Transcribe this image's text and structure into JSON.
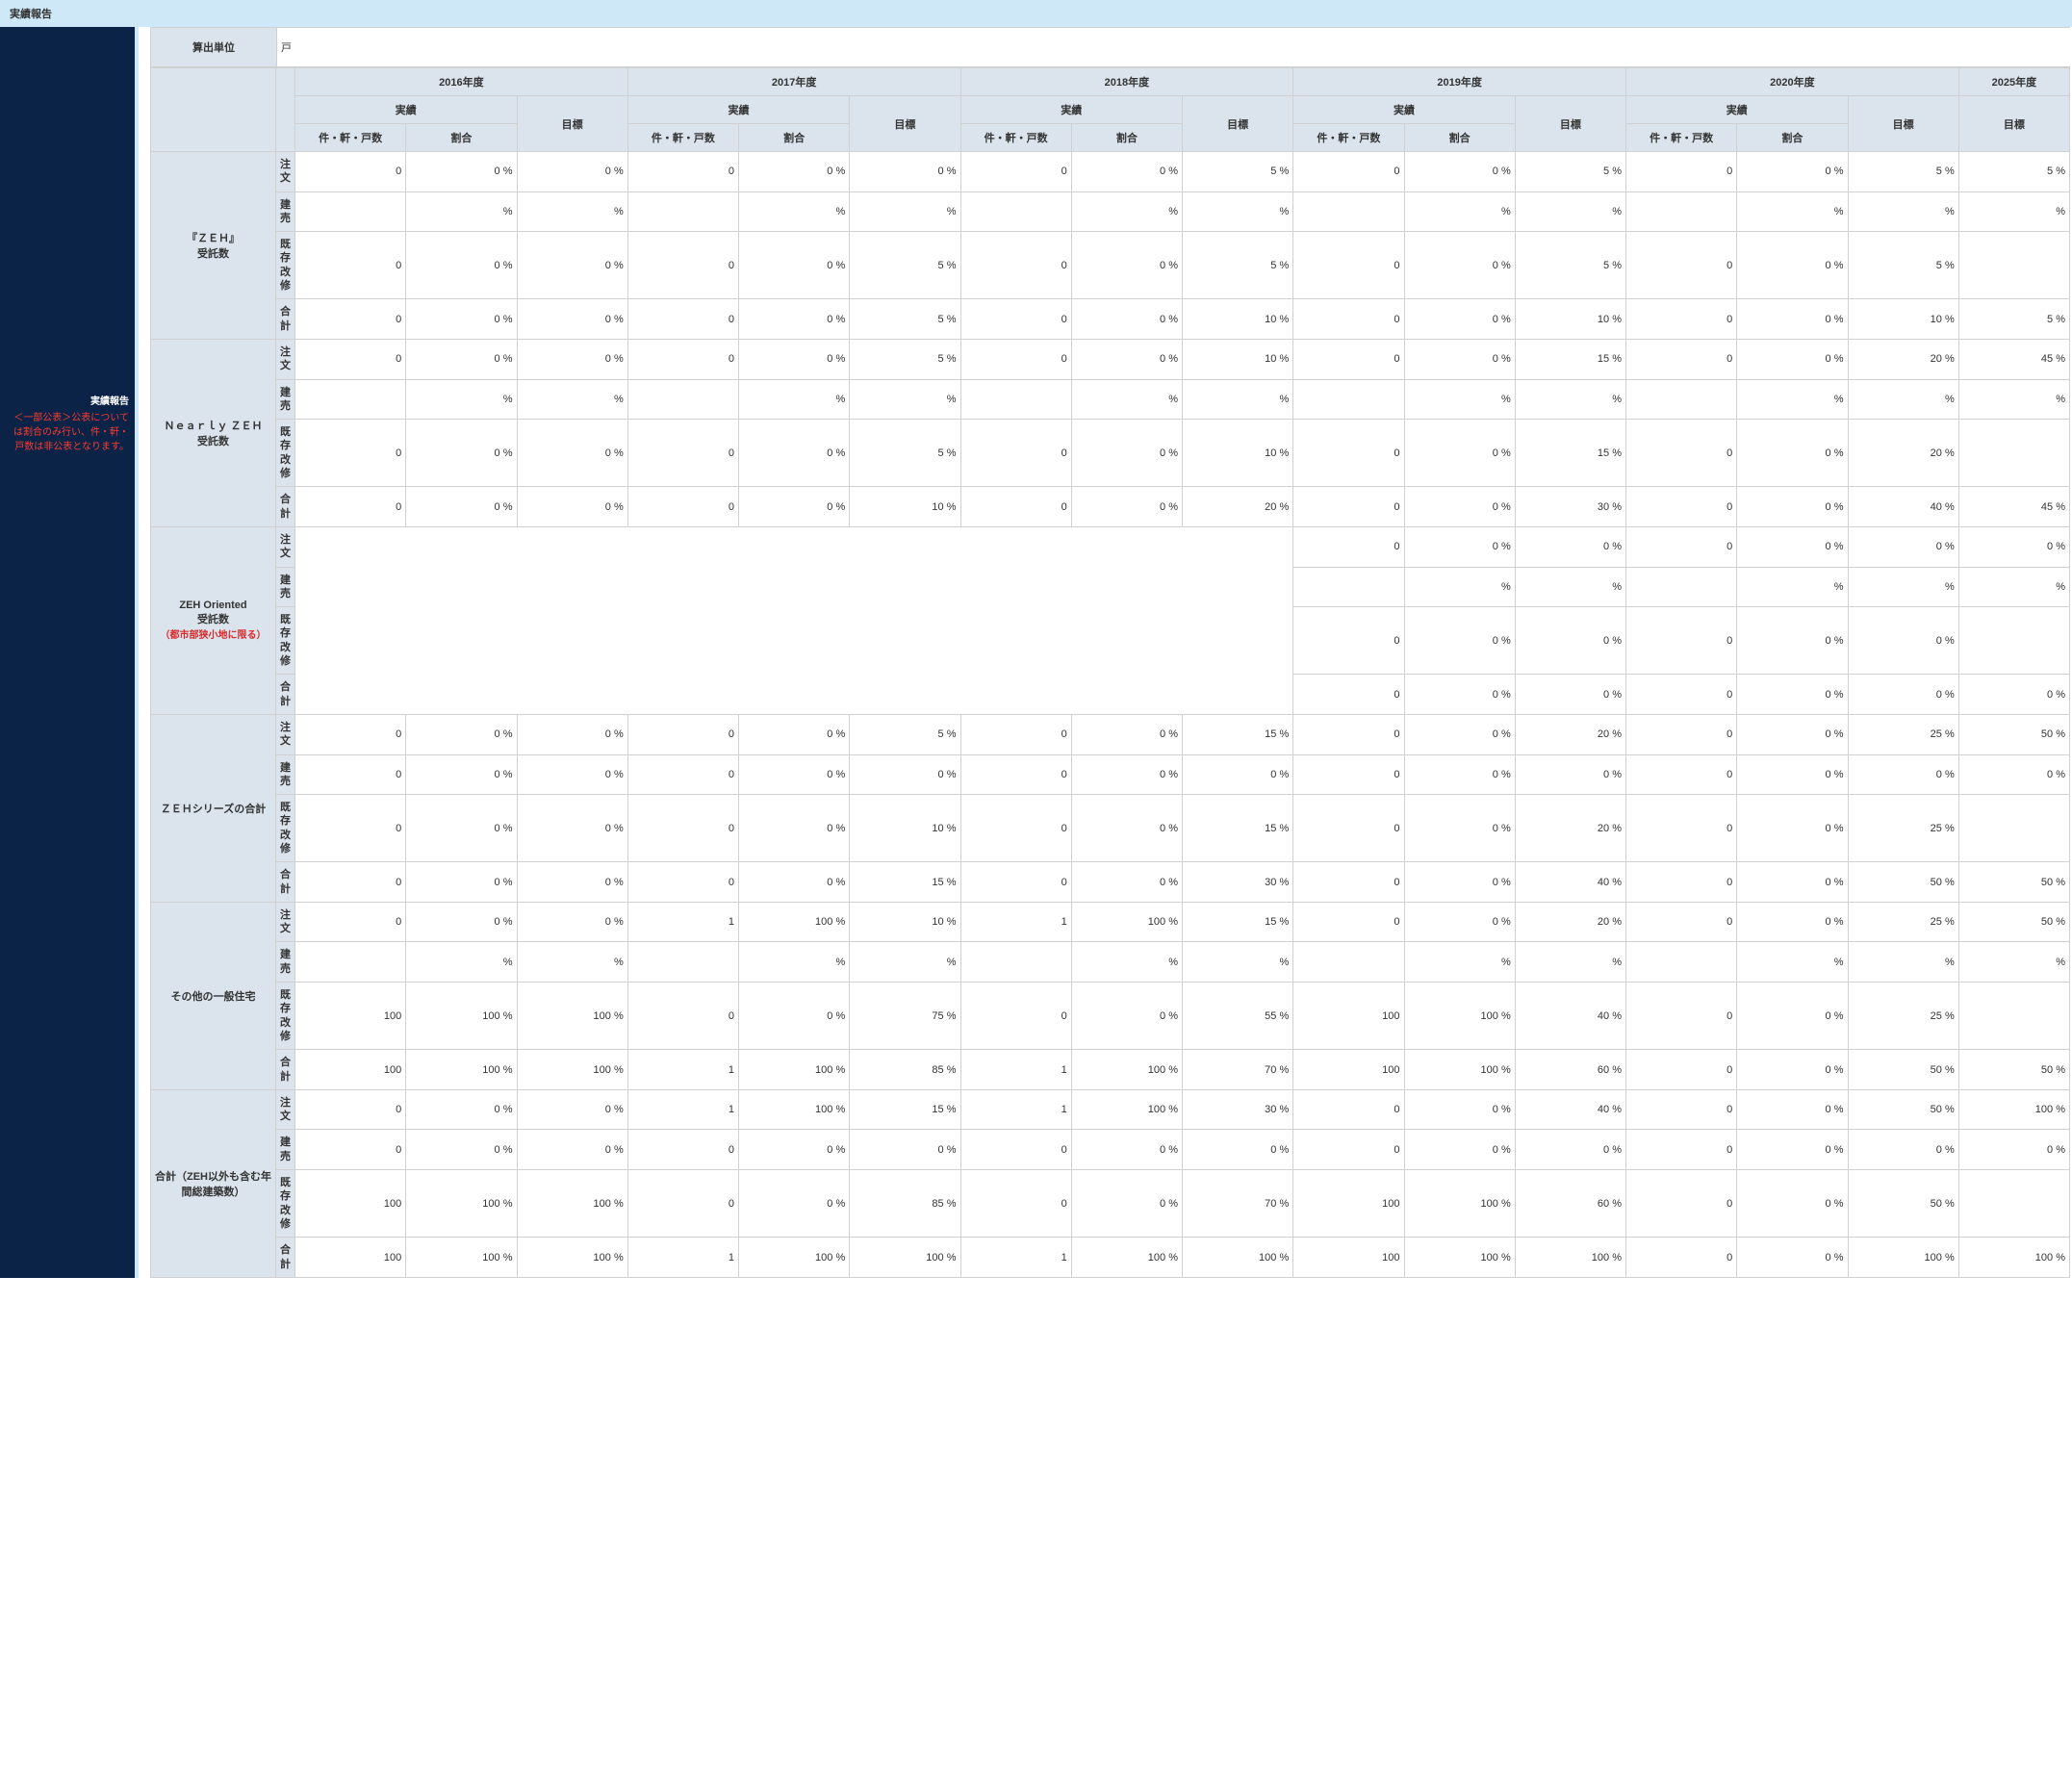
{
  "page_title": "実績報告",
  "sidebar": {
    "heading": "実績報告",
    "note_line1": "＜一部公表＞公表については割合のみ行い、件・軒・戸数は非公表となります。"
  },
  "unit_row": {
    "label": "算出単位",
    "value": "戸"
  },
  "years": [
    "2016年度",
    "2017年度",
    "2018年度",
    "2019年度",
    "2020年度",
    "2025年度"
  ],
  "sub_headers": {
    "actual": "実績",
    "count": "件・軒・戸数",
    "ratio": "割合",
    "target": "目標"
  },
  "sub_short_count": "件・軒・戸数",
  "row_sub_labels": [
    "注文",
    "建売",
    "既存改修",
    "合計"
  ],
  "categories": [
    {
      "name_line1": "『ＺＥＨ』",
      "name_line2": "受託数",
      "rows": [
        {
          "cells": [
            "0",
            "0 %",
            "0 %",
            "0",
            "0 %",
            "0 %",
            "0",
            "0 %",
            "5 %",
            "0",
            "0 %",
            "5 %",
            "0",
            "0 %",
            "5 %",
            "5 %"
          ]
        },
        {
          "cells": [
            "",
            "%",
            "%",
            "",
            "%",
            "%",
            "",
            "%",
            "%",
            "",
            "%",
            "%",
            "",
            "%",
            "%",
            "%"
          ]
        },
        {
          "cells": [
            "0",
            "0 %",
            "0 %",
            "0",
            "0 %",
            "5 %",
            "0",
            "0 %",
            "5 %",
            "0",
            "0 %",
            "5 %",
            "0",
            "0 %",
            "5 %",
            ""
          ]
        },
        {
          "cells": [
            "0",
            "0 %",
            "0 %",
            "0",
            "0 %",
            "5 %",
            "0",
            "0 %",
            "10 %",
            "0",
            "0 %",
            "10 %",
            "0",
            "0 %",
            "10 %",
            "5 %"
          ]
        }
      ]
    },
    {
      "name_line1": "Ｎｅａｒｌｙ ＺＥＨ",
      "name_line2": "受託数",
      "rows": [
        {
          "cells": [
            "0",
            "0 %",
            "0 %",
            "0",
            "0 %",
            "5 %",
            "0",
            "0 %",
            "10 %",
            "0",
            "0 %",
            "15 %",
            "0",
            "0 %",
            "20 %",
            "45 %"
          ]
        },
        {
          "cells": [
            "",
            "%",
            "%",
            "",
            "%",
            "%",
            "",
            "%",
            "%",
            "",
            "%",
            "%",
            "",
            "%",
            "%",
            "%"
          ]
        },
        {
          "cells": [
            "0",
            "0 %",
            "0 %",
            "0",
            "0 %",
            "5 %",
            "0",
            "0 %",
            "10 %",
            "0",
            "0 %",
            "15 %",
            "0",
            "0 %",
            "20 %",
            ""
          ]
        },
        {
          "cells": [
            "0",
            "0 %",
            "0 %",
            "0",
            "0 %",
            "10 %",
            "0",
            "0 %",
            "20 %",
            "0",
            "0 %",
            "30 %",
            "0",
            "0 %",
            "40 %",
            "45 %"
          ]
        }
      ]
    },
    {
      "name_line1": "ZEH Oriented",
      "name_line2": "受託数",
      "name_line3": "（都市部狭小地に限る）",
      "span2019_2025": true,
      "rows": [
        {
          "cells": [
            "0",
            "0 %",
            "0 %",
            "0",
            "0 %",
            "0 %",
            "0 %"
          ]
        },
        {
          "cells": [
            "",
            "%",
            "%",
            "",
            "%",
            "%",
            "%"
          ]
        },
        {
          "cells": [
            "0",
            "0 %",
            "0 %",
            "0",
            "0 %",
            "0 %",
            ""
          ]
        },
        {
          "cells": [
            "0",
            "0 %",
            "0 %",
            "0",
            "0 %",
            "0 %",
            "0 %"
          ]
        }
      ]
    },
    {
      "name_line1": "ＺＥＨシリーズの合計",
      "rows": [
        {
          "cells": [
            "0",
            "0 %",
            "0 %",
            "0",
            "0 %",
            "5 %",
            "0",
            "0 %",
            "15 %",
            "0",
            "0 %",
            "20 %",
            "0",
            "0 %",
            "25 %",
            "50 %"
          ]
        },
        {
          "cells": [
            "0",
            "0 %",
            "0 %",
            "0",
            "0 %",
            "0 %",
            "0",
            "0 %",
            "0 %",
            "0",
            "0 %",
            "0 %",
            "0",
            "0 %",
            "0 %",
            "0 %"
          ]
        },
        {
          "cells": [
            "0",
            "0 %",
            "0 %",
            "0",
            "0 %",
            "10 %",
            "0",
            "0 %",
            "15 %",
            "0",
            "0 %",
            "20 %",
            "0",
            "0 %",
            "25 %",
            ""
          ]
        },
        {
          "cells": [
            "0",
            "0 %",
            "0 %",
            "0",
            "0 %",
            "15 %",
            "0",
            "0 %",
            "30 %",
            "0",
            "0 %",
            "40 %",
            "0",
            "0 %",
            "50 %",
            "50 %"
          ]
        }
      ]
    },
    {
      "name_line1": "その他の一般住宅",
      "rows": [
        {
          "cells": [
            "0",
            "0 %",
            "0 %",
            "1",
            "100 %",
            "10 %",
            "1",
            "100 %",
            "15 %",
            "0",
            "0 %",
            "20 %",
            "0",
            "0 %",
            "25 %",
            "50 %"
          ]
        },
        {
          "cells": [
            "",
            "%",
            "%",
            "",
            "%",
            "%",
            "",
            "%",
            "%",
            "",
            "%",
            "%",
            "",
            "%",
            "%",
            "%"
          ]
        },
        {
          "cells": [
            "100",
            "100 %",
            "100 %",
            "0",
            "0 %",
            "75 %",
            "0",
            "0 %",
            "55 %",
            "100",
            "100 %",
            "40 %",
            "0",
            "0 %",
            "25 %",
            ""
          ]
        },
        {
          "cells": [
            "100",
            "100 %",
            "100 %",
            "1",
            "100 %",
            "85 %",
            "1",
            "100 %",
            "70 %",
            "100",
            "100 %",
            "60 %",
            "0",
            "0 %",
            "50 %",
            "50 %"
          ]
        }
      ]
    },
    {
      "name_line1": "合計（ZEH以外も含む年間総建築数）",
      "rows": [
        {
          "cells": [
            "0",
            "0 %",
            "0 %",
            "1",
            "100 %",
            "15 %",
            "1",
            "100 %",
            "30 %",
            "0",
            "0 %",
            "40 %",
            "0",
            "0 %",
            "50 %",
            "100 %"
          ]
        },
        {
          "cells": [
            "0",
            "0 %",
            "0 %",
            "0",
            "0 %",
            "0 %",
            "0",
            "0 %",
            "0 %",
            "0",
            "0 %",
            "0 %",
            "0",
            "0 %",
            "0 %",
            "0 %"
          ]
        },
        {
          "cells": [
            "100",
            "100 %",
            "100 %",
            "0",
            "0 %",
            "85 %",
            "0",
            "0 %",
            "70 %",
            "100",
            "100 %",
            "60 %",
            "0",
            "0 %",
            "50 %",
            ""
          ]
        },
        {
          "cells": [
            "100",
            "100 %",
            "100 %",
            "1",
            "100 %",
            "100 %",
            "1",
            "100 %",
            "100 %",
            "100",
            "100 %",
            "100 %",
            "0",
            "0 %",
            "100 %",
            "100 %"
          ]
        }
      ]
    }
  ]
}
